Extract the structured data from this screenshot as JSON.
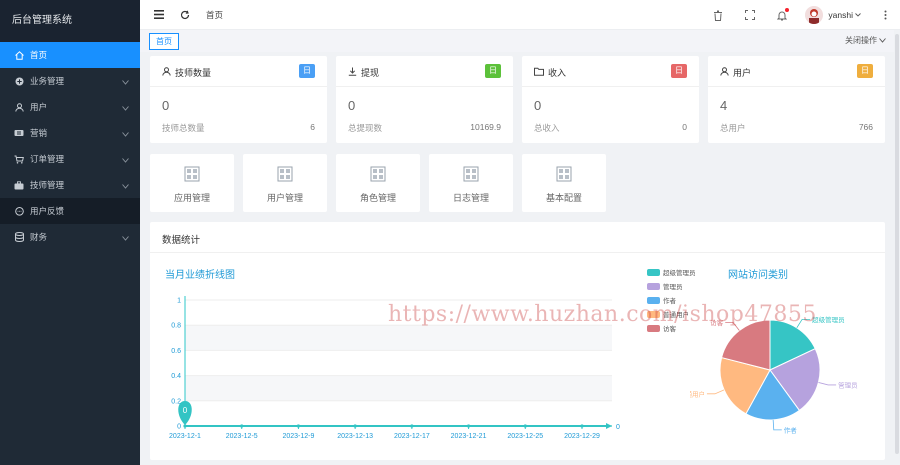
{
  "sidebar": {
    "title": "后台管理系统",
    "items": [
      {
        "label": "首页",
        "icon": "home-icon",
        "active": true,
        "expandable": false
      },
      {
        "label": "业务管理",
        "icon": "plus-circle-icon",
        "expandable": true
      },
      {
        "label": "用户",
        "icon": "user-icon",
        "expandable": true
      },
      {
        "label": "营销",
        "icon": "ticket-icon",
        "expandable": true
      },
      {
        "label": "订单管理",
        "icon": "cart-icon",
        "expandable": true
      },
      {
        "label": "技师管理",
        "icon": "briefcase-icon",
        "expandable": true
      },
      {
        "label": "用户反馈",
        "icon": "chat-icon",
        "expandable": false
      },
      {
        "label": "财务",
        "icon": "database-icon",
        "expandable": true
      }
    ]
  },
  "header": {
    "home_link": "首页",
    "username": "yanshi"
  },
  "tabs": {
    "items": [
      "首页"
    ],
    "close_ops": "关闭操作"
  },
  "colors": {
    "accent": "#1890ff",
    "sidebar_bg": "#1f2a36",
    "badge_blue": "#4a9ff5",
    "badge_green": "#5cc13a",
    "badge_red": "#e66767",
    "badge_orange": "#efae3e",
    "chart_title": "#1e9ad6",
    "line": "#33c4c4"
  },
  "cards": [
    {
      "title": "技师数量",
      "icon": "user-icon",
      "badge": "日",
      "value": "0",
      "sub_label": "技师总数量",
      "sub_value": "6"
    },
    {
      "title": "提现",
      "icon": "download-icon",
      "badge": "日",
      "value": "0",
      "sub_label": "总提现数",
      "sub_value": "10169.9"
    },
    {
      "title": "收入",
      "icon": "folder-icon",
      "badge": "日",
      "value": "0",
      "sub_label": "总收入",
      "sub_value": "0"
    },
    {
      "title": "用户",
      "icon": "user-icon",
      "badge": "日",
      "value": "4",
      "sub_label": "总用户",
      "sub_value": "766"
    }
  ],
  "quick_links": [
    {
      "label": "应用管理",
      "icon": "app-grid-icon"
    },
    {
      "label": "用户管理",
      "icon": "app-grid-icon"
    },
    {
      "label": "角色管理",
      "icon": "app-grid-icon"
    },
    {
      "label": "日志管理",
      "icon": "app-grid-icon"
    },
    {
      "label": "基本配置",
      "icon": "app-grid-icon"
    }
  ],
  "panel": {
    "title": "数据统计"
  },
  "watermark": "https://www.huzhan.com/ishop47855",
  "chart_data": [
    {
      "type": "line",
      "title": "当月业绩折线图",
      "x": [
        "2023-12-1",
        "2023-12-5",
        "2023-12-9",
        "2023-12-13",
        "2023-12-17",
        "2023-12-21",
        "2023-12-25",
        "2023-12-29"
      ],
      "values": [
        0,
        0,
        0,
        0,
        0,
        0,
        0,
        0
      ],
      "ylim": [
        0,
        1
      ],
      "yticks": [
        "0",
        "0.2",
        "0.4",
        "0.6",
        "0.8",
        "1"
      ],
      "marker_label": "0",
      "end_label": "0",
      "grid": true
    },
    {
      "type": "pie",
      "title": "网站访问类别",
      "legend_position": "top-left",
      "slices": [
        {
          "name": "超级管理员",
          "value": 18,
          "color": "#36c5c5"
        },
        {
          "name": "管理员",
          "value": 22,
          "color": "#b6a2de"
        },
        {
          "name": "作者",
          "value": 18,
          "color": "#5ab1ef"
        },
        {
          "name": "普通用户",
          "value": 21,
          "color": "#ffb980"
        },
        {
          "name": "访客",
          "value": 21,
          "color": "#d87a80"
        }
      ]
    }
  ]
}
